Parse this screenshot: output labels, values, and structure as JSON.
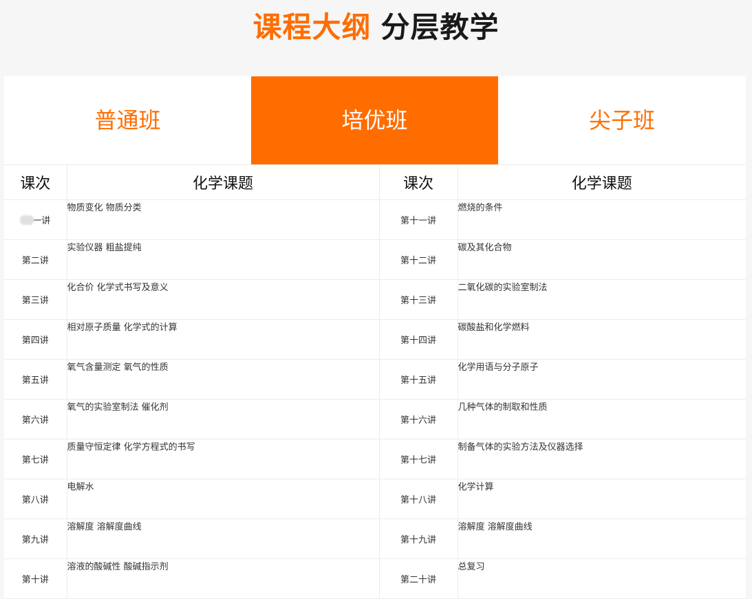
{
  "heading": {
    "accent": "课程大纲",
    "main": "分层教学"
  },
  "tabs": [
    {
      "label": "普通班",
      "active": false
    },
    {
      "label": "培优班",
      "active": true
    },
    {
      "label": "尖子班",
      "active": false
    }
  ],
  "table": {
    "headers": [
      "课次",
      "化学课题",
      "课次",
      "化学课题"
    ],
    "rows": [
      {
        "left_no": "一讲",
        "left_topic": "物质变化 物质分类",
        "right_no": "第十一讲",
        "right_topic": "燃烧的条件"
      },
      {
        "left_no": "第二讲",
        "left_topic": "实验仪器 粗盐提纯",
        "right_no": "第十二讲",
        "right_topic": "碳及其化合物"
      },
      {
        "left_no": "第三讲",
        "left_topic": "化合价 化学式书写及意义",
        "right_no": "第十三讲",
        "right_topic": "二氧化碳的实验室制法"
      },
      {
        "left_no": "第四讲",
        "left_topic": "相对原子质量 化学式的计算",
        "right_no": "第十四讲",
        "right_topic": "碳酸盐和化学燃料"
      },
      {
        "left_no": "第五讲",
        "left_topic": "氧气含量测定 氧气的性质",
        "right_no": "第十五讲",
        "right_topic": "化学用语与分子原子"
      },
      {
        "left_no": "第六讲",
        "left_topic": "氧气的实验室制法 催化剂",
        "right_no": "第十六讲",
        "right_topic": "几种气体的制取和性质"
      },
      {
        "left_no": "第七讲",
        "left_topic": "质量守恒定律 化学方程式的书写",
        "right_no": "第十七讲",
        "right_topic": "制备气体的实验方法及仪器选择"
      },
      {
        "left_no": "第八讲",
        "left_topic": "电解水",
        "right_no": "第十八讲",
        "right_topic": "化学计算"
      },
      {
        "left_no": "第九讲",
        "left_topic": "溶解度 溶解度曲线",
        "right_no": "第十九讲",
        "right_topic": "溶解度 溶解度曲线"
      },
      {
        "left_no": "第十讲",
        "left_topic": "溶液的酸碱性 酸碱指示剂",
        "right_no": "第二十讲",
        "right_topic": "总复习"
      }
    ]
  },
  "colors": {
    "accent": "#ff6d00",
    "background": "#f6f6f6"
  }
}
